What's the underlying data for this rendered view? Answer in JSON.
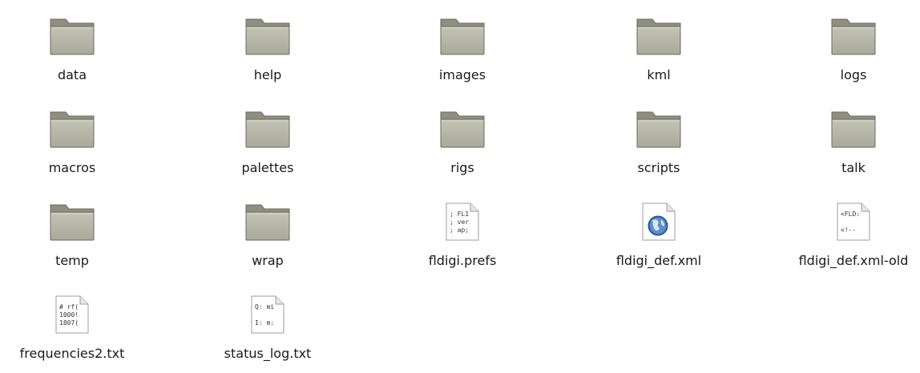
{
  "files": [
    {
      "name": "data",
      "type": "folder",
      "icon": "folder-icon"
    },
    {
      "name": "help",
      "type": "folder",
      "icon": "folder-icon"
    },
    {
      "name": "images",
      "type": "folder",
      "icon": "folder-icon"
    },
    {
      "name": "kml",
      "type": "folder",
      "icon": "folder-icon"
    },
    {
      "name": "logs",
      "type": "folder",
      "icon": "folder-icon"
    },
    {
      "name": "macros",
      "type": "folder",
      "icon": "folder-icon"
    },
    {
      "name": "palettes",
      "type": "folder",
      "icon": "folder-icon"
    },
    {
      "name": "rigs",
      "type": "folder",
      "icon": "folder-icon"
    },
    {
      "name": "scripts",
      "type": "folder",
      "icon": "folder-icon"
    },
    {
      "name": "talk",
      "type": "folder",
      "icon": "folder-icon"
    },
    {
      "name": "temp",
      "type": "folder",
      "icon": "folder-icon"
    },
    {
      "name": "wrap",
      "type": "folder",
      "icon": "folder-icon"
    },
    {
      "name": "fldigi.prefs",
      "type": "text",
      "icon": "text-file-icon",
      "preview": [
        "; FL1",
        "; ver",
        "; ap;"
      ]
    },
    {
      "name": "fldigi_def.xml",
      "type": "xml",
      "icon": "xml-globe-file-icon"
    },
    {
      "name": "fldigi_def.xml-old",
      "type": "text",
      "icon": "text-file-icon",
      "preview": [
        "<FLD:",
        "",
        "<!--"
      ]
    },
    {
      "name": "frequencies2.txt",
      "type": "text",
      "icon": "text-file-icon",
      "preview": [
        "# rf(",
        "1000!",
        "1807("
      ]
    },
    {
      "name": "status_log.txt",
      "type": "text",
      "icon": "text-file-icon",
      "preview": [
        "Q: mi",
        "",
        "I: m:"
      ]
    }
  ],
  "colors": {
    "folder_body": "#a9a99b",
    "folder_tab": "#8f8f80",
    "folder_outline": "#6b6b5e",
    "label_text": "#1a1a1a"
  }
}
